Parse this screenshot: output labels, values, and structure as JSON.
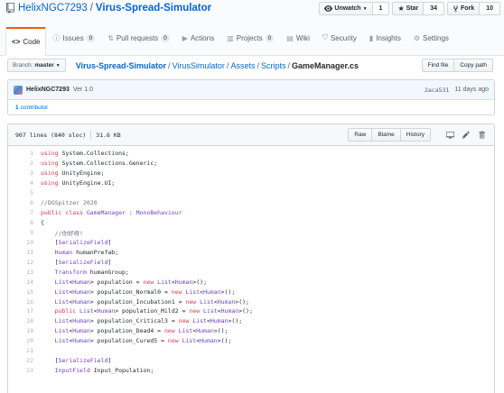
{
  "repo": {
    "owner": "HelixNGC7293",
    "separator": "/",
    "name": "Virus-Spread-Simulator"
  },
  "actions": {
    "watch": {
      "label": "Unwatch",
      "count": "1"
    },
    "star": {
      "label": "Star",
      "count": "34"
    },
    "fork": {
      "label": "Fork",
      "count": "10"
    }
  },
  "tabs": [
    {
      "label": "Code",
      "icon": "code-icon"
    },
    {
      "label": "Issues",
      "count": "0",
      "icon": "issue-icon"
    },
    {
      "label": "Pull requests",
      "count": "0",
      "icon": "pull-request-icon"
    },
    {
      "label": "Actions",
      "icon": "play-icon"
    },
    {
      "label": "Projects",
      "count": "0",
      "icon": "project-icon"
    },
    {
      "label": "Wiki",
      "icon": "book-icon"
    },
    {
      "label": "Security",
      "icon": "shield-icon"
    },
    {
      "label": "Insights",
      "icon": "graph-icon"
    },
    {
      "label": "Settings",
      "icon": "gear-icon"
    }
  ],
  "filenav": {
    "branch_label": "Branch:",
    "branch": "master",
    "path": [
      "Virus-Spread-Simulator",
      "VirusSimulator",
      "Assets",
      "Scripts"
    ],
    "filename": "GameManager.cs",
    "find_file": "Find file",
    "copy_path": "Copy path"
  },
  "commit": {
    "author": "HelixNGC7293",
    "message": "Ver 1.0",
    "sha": "2aca531",
    "time": "11 days ago",
    "contributors_count": "1",
    "contributors_label": "contributor"
  },
  "file": {
    "lines_info": "907 lines (840 sloc)",
    "size": "31.6 KB",
    "raw": "Raw",
    "blame": "Blame",
    "history": "History"
  },
  "code": [
    {
      "n": "1",
      "parts": [
        [
          "k",
          "using"
        ],
        [
          "i",
          " System.Collections;"
        ]
      ]
    },
    {
      "n": "2",
      "parts": [
        [
          "k",
          "using"
        ],
        [
          "i",
          " System.Collections.Generic;"
        ]
      ]
    },
    {
      "n": "3",
      "parts": [
        [
          "k",
          "using"
        ],
        [
          "i",
          " UnityEngine;"
        ]
      ]
    },
    {
      "n": "4",
      "parts": [
        [
          "k",
          "using"
        ],
        [
          "i",
          " UnityEngine.UI;"
        ]
      ]
    },
    {
      "n": "5",
      "parts": []
    },
    {
      "n": "6",
      "parts": [
        [
          "c",
          "//DGSpitzer 2020"
        ]
      ]
    },
    {
      "n": "7",
      "parts": [
        [
          "k",
          "public class "
        ],
        [
          "t",
          "GameManager"
        ],
        [
          "i",
          " : "
        ],
        [
          "t",
          "MonoBehaviour"
        ]
      ]
    },
    {
      "n": "8",
      "parts": [
        [
          "i",
          "{"
        ]
      ]
    },
    {
      "n": "9",
      "parts": [
        [
          "c",
          "    //你好呀!"
        ]
      ]
    },
    {
      "n": "10",
      "parts": [
        [
          "i",
          "    ["
        ],
        [
          "t",
          "SerializeField"
        ],
        [
          "i",
          "]"
        ]
      ]
    },
    {
      "n": "11",
      "parts": [
        [
          "t",
          "    Human"
        ],
        [
          "i",
          " humanPrefab;"
        ]
      ]
    },
    {
      "n": "12",
      "parts": [
        [
          "i",
          "    ["
        ],
        [
          "t",
          "SerializeField"
        ],
        [
          "i",
          "]"
        ]
      ]
    },
    {
      "n": "13",
      "parts": [
        [
          "t",
          "    Transform"
        ],
        [
          "i",
          " humanGroup;"
        ]
      ]
    },
    {
      "n": "14",
      "parts": [
        [
          "t",
          "    List"
        ],
        [
          "i",
          "<"
        ],
        [
          "t",
          "Human"
        ],
        [
          "i",
          "> population = "
        ],
        [
          "k",
          "new "
        ],
        [
          "t",
          "List"
        ],
        [
          "i",
          "<"
        ],
        [
          "t",
          "Human"
        ],
        [
          "i",
          ">();"
        ]
      ]
    },
    {
      "n": "15",
      "parts": [
        [
          "t",
          "    List"
        ],
        [
          "i",
          "<"
        ],
        [
          "t",
          "Human"
        ],
        [
          "i",
          "> population_Normal0 = "
        ],
        [
          "k",
          "new "
        ],
        [
          "t",
          "List"
        ],
        [
          "i",
          "<"
        ],
        [
          "t",
          "Human"
        ],
        [
          "i",
          ">();"
        ]
      ]
    },
    {
      "n": "16",
      "parts": [
        [
          "t",
          "    List"
        ],
        [
          "i",
          "<"
        ],
        [
          "t",
          "Human"
        ],
        [
          "i",
          "> population_Incubation1 = "
        ],
        [
          "k",
          "new "
        ],
        [
          "t",
          "List"
        ],
        [
          "i",
          "<"
        ],
        [
          "t",
          "Human"
        ],
        [
          "i",
          ">();"
        ]
      ]
    },
    {
      "n": "17",
      "parts": [
        [
          "k",
          "    public "
        ],
        [
          "t",
          "List"
        ],
        [
          "i",
          "<"
        ],
        [
          "t",
          "Human"
        ],
        [
          "i",
          "> population_Mild2 = "
        ],
        [
          "k",
          "new "
        ],
        [
          "t",
          "List"
        ],
        [
          "i",
          "<"
        ],
        [
          "t",
          "Human"
        ],
        [
          "i",
          ">();"
        ]
      ]
    },
    {
      "n": "18",
      "parts": [
        [
          "t",
          "    List"
        ],
        [
          "i",
          "<"
        ],
        [
          "t",
          "Human"
        ],
        [
          "i",
          "> population_Critical3 = "
        ],
        [
          "k",
          "new "
        ],
        [
          "t",
          "List"
        ],
        [
          "i",
          "<"
        ],
        [
          "t",
          "Human"
        ],
        [
          "i",
          ">();"
        ]
      ]
    },
    {
      "n": "19",
      "parts": [
        [
          "t",
          "    List"
        ],
        [
          "i",
          "<"
        ],
        [
          "t",
          "Human"
        ],
        [
          "i",
          "> population_Dead4 = "
        ],
        [
          "k",
          "new "
        ],
        [
          "t",
          "List"
        ],
        [
          "i",
          "<"
        ],
        [
          "t",
          "Human"
        ],
        [
          "i",
          ">();"
        ]
      ]
    },
    {
      "n": "20",
      "parts": [
        [
          "t",
          "    List"
        ],
        [
          "i",
          "<"
        ],
        [
          "t",
          "Human"
        ],
        [
          "i",
          "> population_Cured5 = "
        ],
        [
          "k",
          "new "
        ],
        [
          "t",
          "List"
        ],
        [
          "i",
          "<"
        ],
        [
          "t",
          "Human"
        ],
        [
          "i",
          ">();"
        ]
      ]
    },
    {
      "n": "21",
      "parts": []
    },
    {
      "n": "22",
      "parts": [
        [
          "i",
          "    ["
        ],
        [
          "t",
          "SerializeField"
        ],
        [
          "i",
          "]"
        ]
      ]
    },
    {
      "n": "23",
      "parts": [
        [
          "t",
          "    InputField"
        ],
        [
          "i",
          " Input_Population;"
        ]
      ]
    }
  ],
  "colors": {
    "link": "#0366d6",
    "keyword": "#d73a49",
    "type": "#6f42c1",
    "comment": "#6a737d",
    "accent": "#e36209"
  }
}
